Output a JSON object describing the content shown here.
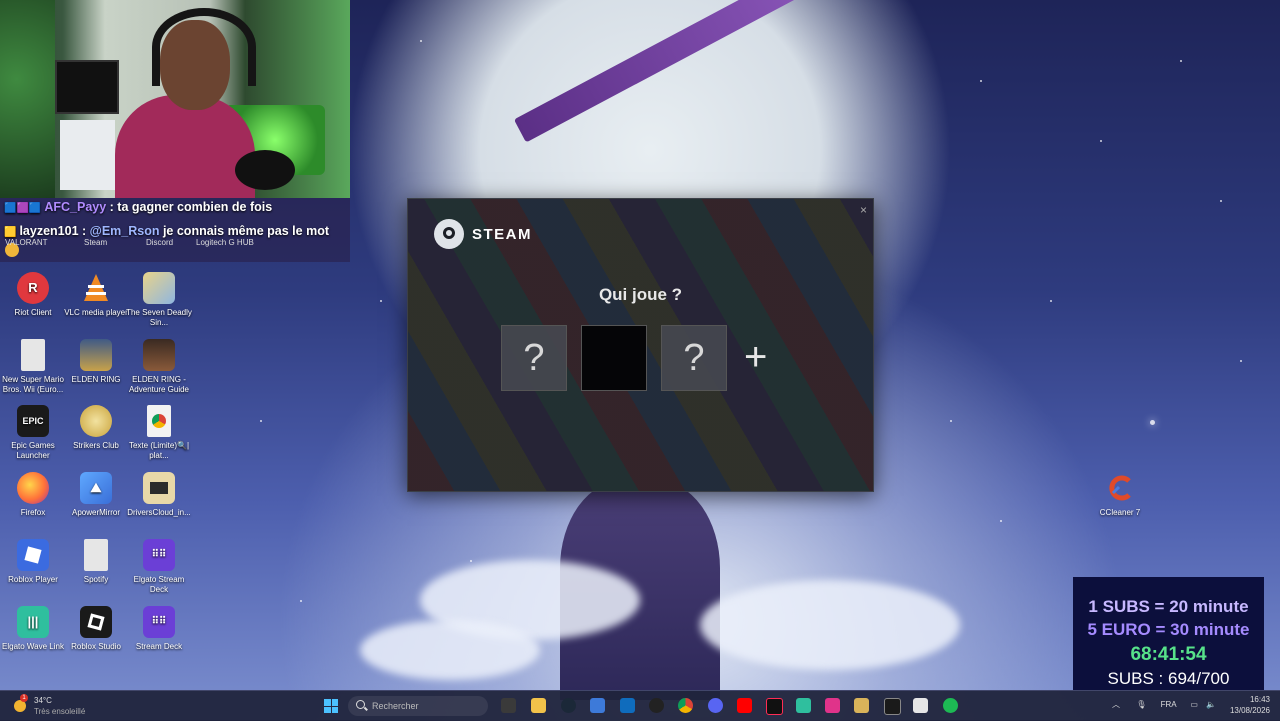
{
  "chat": {
    "line1_user": "AFC_Payy",
    "line1_text": " : ta gagner combien de fois",
    "line2_user": "layzen101",
    "line2_sep": " : ",
    "line2_mention": "@Em_Rson",
    "line2_text": " je connais même pas le mot",
    "under_labels": [
      "VALORANT",
      "Steam",
      "Discord",
      "Logitech G HUB"
    ]
  },
  "desktop_icons": [
    {
      "label": "Riot Client",
      "icon": "riot-icon",
      "color": "#e0383e"
    },
    {
      "label": "VLC media player",
      "icon": "vlc-icon",
      "color": "#f08a24"
    },
    {
      "label": "The Seven Deadly Sin...",
      "icon": "seven-deadly-sins-icon",
      "color": "#c9b37a"
    },
    {
      "label": "New Super Mario Bros. Wii (Euro...",
      "icon": "file-icon",
      "color": "#d9d9d9"
    },
    {
      "label": "ELDEN RING",
      "icon": "elden-ring-icon",
      "color": "#7a6a3a"
    },
    {
      "label": "ELDEN RING - Adventure Guide",
      "icon": "elden-ring-guide-icon",
      "color": "#5a3a2a"
    },
    {
      "label": "Epic Games Launcher",
      "icon": "epic-games-icon",
      "color": "#1a1a1a"
    },
    {
      "label": "Strikers Club",
      "icon": "strikers-club-icon",
      "color": "#c9a23a"
    },
    {
      "label": "Texte (Limite)🔍| plat...",
      "icon": "chrome-icon",
      "color": "#e8e8e8"
    },
    {
      "label": "Firefox",
      "icon": "firefox-icon",
      "color": "#ff7139"
    },
    {
      "label": "ApowerMirror",
      "icon": "apowermirror-icon",
      "color": "#4a90e2"
    },
    {
      "label": "DriversCloud_in...",
      "icon": "drivers-cloud-icon",
      "color": "#2b2b2b"
    },
    {
      "label": "Roblox Player",
      "icon": "roblox-player-icon",
      "color": "#3b6be0"
    },
    {
      "label": "Spotify",
      "icon": "file-icon",
      "color": "#d9d9d9"
    },
    {
      "label": "Elgato Stream Deck",
      "icon": "stream-deck-icon",
      "color": "#6b3fd6"
    },
    {
      "label": "Elgato Wave Link",
      "icon": "wave-link-icon",
      "color": "#2fbf9e"
    },
    {
      "label": "Roblox Studio",
      "icon": "roblox-studio-icon",
      "color": "#1a1a1a"
    },
    {
      "label": "Stream Deck",
      "icon": "stream-deck-icon",
      "color": "#6b3fd6"
    },
    {
      "label": "CCleaner 7",
      "icon": "ccleaner-icon",
      "color": "#d9532b"
    }
  ],
  "steam": {
    "brand": "STEAM",
    "title": "Qui joue ?",
    "profile_unknown": "?",
    "add_symbol": "+",
    "close": "×"
  },
  "counter": {
    "line1": "1 SUBS = 20 minute",
    "line2": "5 EURO = 30 minute",
    "timer": "68:41:54",
    "subs": "SUBS : 694/700"
  },
  "taskbar": {
    "notification_count": "1",
    "temperature": "34°C",
    "weather": "Très ensoleillé",
    "search_placeholder": "Recherher",
    "search_label": "Rechercher",
    "language": "FRA",
    "time": "16:43",
    "date": "13/08/2026",
    "apps": [
      "file-explorer-icon",
      "folder-icon",
      "steam-icon",
      "store-icon",
      "outlook-icon",
      "obs-icon",
      "chrome-icon",
      "discord-icon",
      "youtube-icon",
      "tiktok-icon",
      "wave-link-icon",
      "elgato-icon",
      "mario-icon",
      "epic-games-icon",
      "notepad-icon",
      "spotify-icon"
    ]
  }
}
